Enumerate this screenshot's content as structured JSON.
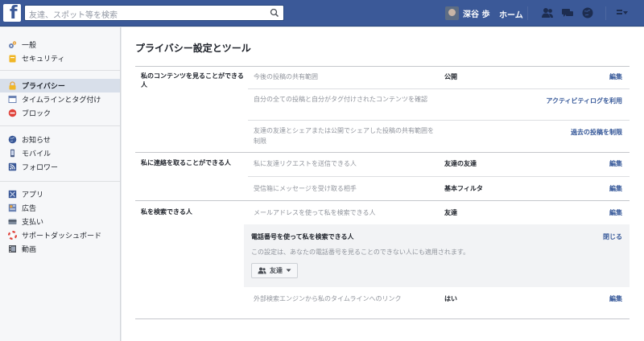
{
  "topbar": {
    "search_placeholder": "友達、スポット等を検索",
    "user_name": "深谷 歩",
    "home_label": "ホーム",
    "brand_color": "#3b5998",
    "logo_letter": "f"
  },
  "sidebar": {
    "groups": [
      [
        {
          "label": "一般",
          "icon": "gear-icon"
        },
        {
          "label": "セキュリティ",
          "icon": "lock-icon"
        }
      ],
      [
        {
          "label": "プライバシー",
          "icon": "privacy-lock-icon",
          "active": true
        },
        {
          "label": "タイムラインとタグ付け",
          "icon": "timeline-icon"
        },
        {
          "label": "ブロック",
          "icon": "block-icon"
        }
      ],
      [
        {
          "label": "お知らせ",
          "icon": "globe-icon"
        },
        {
          "label": "モバイル",
          "icon": "mobile-icon"
        },
        {
          "label": "フォロワー",
          "icon": "rss-icon"
        }
      ],
      [
        {
          "label": "アプリ",
          "icon": "apps-icon"
        },
        {
          "label": "広告",
          "icon": "ads-icon"
        },
        {
          "label": "支払い",
          "icon": "payment-icon"
        },
        {
          "label": "サポートダッシュボード",
          "icon": "lifebuoy-icon"
        },
        {
          "label": "動画",
          "icon": "video-icon"
        }
      ]
    ]
  },
  "main": {
    "title": "プライバシー設定とツール",
    "sections": [
      {
        "label": "私のコンテンツを見ることができる人",
        "rows": [
          {
            "question": "今後の投稿の共有範囲",
            "value": "公開",
            "link": "編集"
          },
          {
            "question": "自分の全ての投稿と自分がタグ付けされたコンテンツを確認",
            "value": "",
            "link": "アクティビティログを利用"
          },
          {
            "question": "友達の友達とシェアまたは公開でシェアした投稿の共有範囲を制限",
            "value": "",
            "link": "過去の投稿を制限"
          }
        ]
      },
      {
        "label": "私に連絡を取ることができる人",
        "rows": [
          {
            "question": "私に友達リクエストを送信できる人",
            "value": "友達の友達",
            "link": "編集"
          },
          {
            "question": "受信箱にメッセージを受け取る相手",
            "value": "基本フィルタ",
            "link": "編集"
          }
        ]
      },
      {
        "label": "私を検索できる人",
        "rows": [
          {
            "question": "メールアドレスを使って私を検索できる人",
            "value": "友達",
            "link": "編集"
          },
          {
            "question": "外部検索エンジンから私のタイムラインへのリンク",
            "value": "はい",
            "link": "編集"
          }
        ],
        "expanded": {
          "title": "電話番号を使って私を検索できる人",
          "close_label": "閉じる",
          "description": "この設定は、あなたの電話番号を見ることのできない人にも適用されます。",
          "audience_label": "友達"
        }
      }
    ]
  }
}
